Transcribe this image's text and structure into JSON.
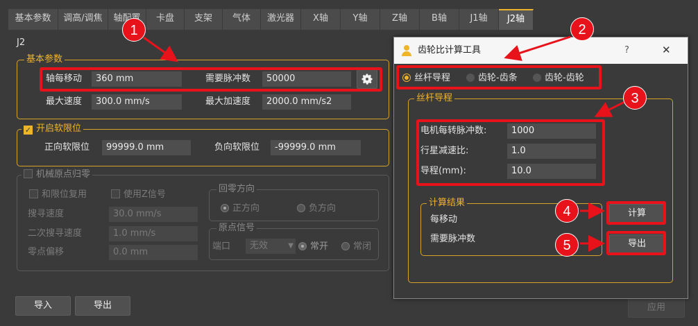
{
  "tabs": [
    "基本参数",
    "调高/调焦",
    "轴配置",
    "卡盘",
    "支架",
    "气体",
    "激光器",
    "X轴",
    "Y轴",
    "Z轴",
    "B轴",
    "J1轴",
    "J2轴"
  ],
  "active_tab": "J2轴",
  "axis_title": "J2",
  "basic": {
    "legend": "基本参数",
    "move_per_rev_label": "轴每移动",
    "move_per_rev": "360 mm",
    "pulses_label": "需要脉冲数",
    "pulses": "50000",
    "max_speed_label": "最大速度",
    "max_speed": "300.0 mm/s",
    "max_accel_label": "最大加速度",
    "max_accel": "2000.0 mm/s2"
  },
  "soft_limit": {
    "legend": "开启软限位",
    "checked": true,
    "pos_label": "正向软限位",
    "pos": "99999.0 mm",
    "neg_label": "负向软限位",
    "neg": "-99999.0 mm"
  },
  "homing": {
    "legend": "机械原点归零",
    "and_limit": "和限位复用",
    "use_z": "使用Z信号",
    "search_speed_label": "搜寻速度",
    "search_speed": "30.0 mm/s",
    "second_speed_label": "二次搜寻速度",
    "second_speed": "1.0 mm/s",
    "offset_label": "零点偏移",
    "offset": "0.0 mm",
    "dir_legend": "回零方向",
    "dir_pos": "正方向",
    "dir_neg": "负方向",
    "signal_legend": "原点信号",
    "port_label": "端口",
    "port_value": "无效",
    "no_label": "常开",
    "nc_label": "常闭"
  },
  "bottom": {
    "import": "导入",
    "export": "导出",
    "apply": "应用"
  },
  "dialog": {
    "title": "齿轮比计算工具",
    "help": "?",
    "close": "✕",
    "modes": [
      "丝杆导程",
      "齿轮-齿条",
      "齿轮-齿轮"
    ],
    "section_legend": "丝杆导程",
    "motor_label": "电机每转脉冲数:",
    "motor_value": "1000",
    "ratio_label": "行星减速比:",
    "ratio_value": "1.0",
    "lead_label": "导程(mm):",
    "lead_value": "10.0",
    "result_legend": "计算结果",
    "result_move": "每移动",
    "result_pulses": "需要脉冲数",
    "calc": "计算",
    "export": "导出"
  },
  "badges": [
    "1",
    "2",
    "3",
    "4",
    "5"
  ],
  "colors": {
    "accent": "#f0b429",
    "annotation": "#e8121b",
    "background": "#3a3a3a"
  }
}
